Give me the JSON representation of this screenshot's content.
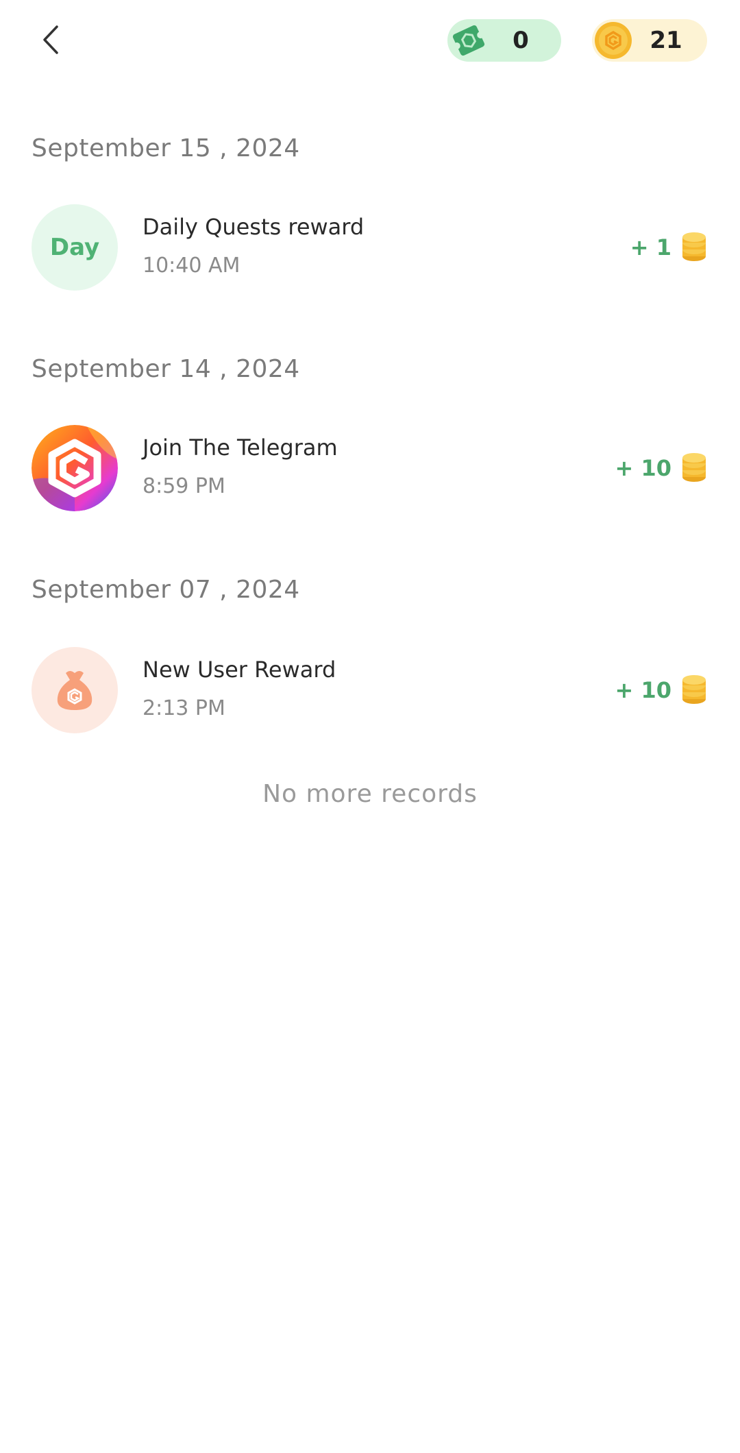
{
  "header": {
    "back_icon": "chevron-left-icon",
    "ticket_balance": "0",
    "ticket_icon": "ticket-icon",
    "coin_balance": "21",
    "coin_icon": "coin-icon"
  },
  "groups": [
    {
      "date": "September 15 , 2024",
      "records": [
        {
          "avatar_type": "day",
          "avatar_text": "Day",
          "title": "Daily Quests reward",
          "time": "10:40 AM",
          "amount": "+ 1"
        }
      ]
    },
    {
      "date": "September 14 , 2024",
      "records": [
        {
          "avatar_type": "telegram",
          "title": "Join The Telegram",
          "time": "8:59 PM",
          "amount": "+ 10"
        }
      ]
    },
    {
      "date": "September 07 , 2024",
      "records": [
        {
          "avatar_type": "money-bag",
          "title": "New User Reward",
          "time": "2:13 PM",
          "amount": "+ 10"
        }
      ]
    }
  ],
  "footer": {
    "no_more_text": "No more records"
  },
  "colors": {
    "accent_green": "#4ca66c",
    "ticket_pill": "#d2f3da",
    "coin_pill": "#fdf3d4",
    "coin_gold": "#f5b82e"
  }
}
